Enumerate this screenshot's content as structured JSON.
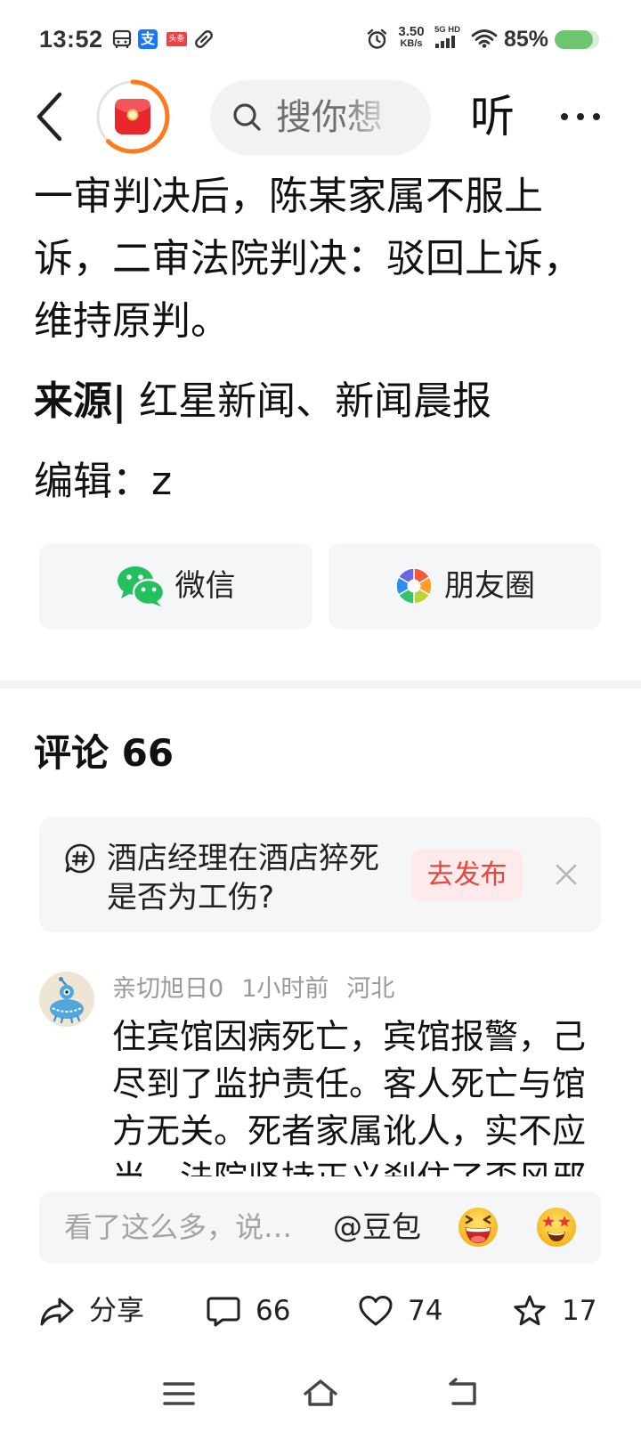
{
  "status_bar": {
    "time": "13:52",
    "notification_icons": [
      "bus-icon",
      "alipay-icon",
      "toutiao-icon",
      "link-icon"
    ],
    "alipay_glyph": "支",
    "toutiao_glyph": "头条",
    "net_speed": "3.50",
    "net_speed_unit": "KB/s",
    "network_type": "5G HD",
    "battery_text": "85%",
    "battery_level": 0.85
  },
  "header": {
    "back_icon": "chevron-left-icon",
    "search_icon": "search-icon",
    "search_placeholder": "搜你想",
    "listen_label": "听",
    "more_icon": "more-dots-icon"
  },
  "article": {
    "body_lines": [
      "一审判决后，陈某家属不服上",
      "诉，二审法院判决：驳回上诉，",
      "维持原判。"
    ],
    "source_label": "来源|",
    "source_text": "红星新闻、新闻晨报",
    "editor": "编辑：z"
  },
  "share": {
    "wechat_label": "微信",
    "wechat_icon": "wechat-icon",
    "moments_label": "朋友圈",
    "moments_icon": "moments-icon"
  },
  "comments": {
    "title": "评论 66",
    "topic": {
      "icon": "hashtag-bubble-icon",
      "lines": [
        "酒店经理在酒店猝死",
        "是否为工伤?"
      ],
      "publish_label": "去发布"
    },
    "items": [
      {
        "user": "亲切旭日0",
        "time": "1小时前",
        "location": "河北",
        "lines": [
          "住宾馆因病死亡，宾馆报警，己",
          "尽到了监护责任。客人死亡与馆",
          "方无关。死者家属讹人，实不应",
          "当，法院坚持正义刹住了歪风邪"
        ]
      }
    ]
  },
  "composer": {
    "placeholder": "看了这么多，说…",
    "mention": "@豆包",
    "emoji_icons": [
      "laughing-emoji-icon",
      "star-struck-emoji-icon"
    ]
  },
  "action_bar": {
    "share_label": "分享",
    "comment_count": "66",
    "like_count": "74",
    "favorite_count": "17"
  },
  "nav_bar": {
    "icons": [
      "menu-icon",
      "home-icon",
      "back-icon"
    ]
  },
  "colors": {
    "accent_red": "#e8453c",
    "card_bg": "#f5f6f7",
    "text": "#111111",
    "muted": "#9a9a9a",
    "battery_green": "#6dc56f",
    "wechat_green": "#22c15e"
  }
}
